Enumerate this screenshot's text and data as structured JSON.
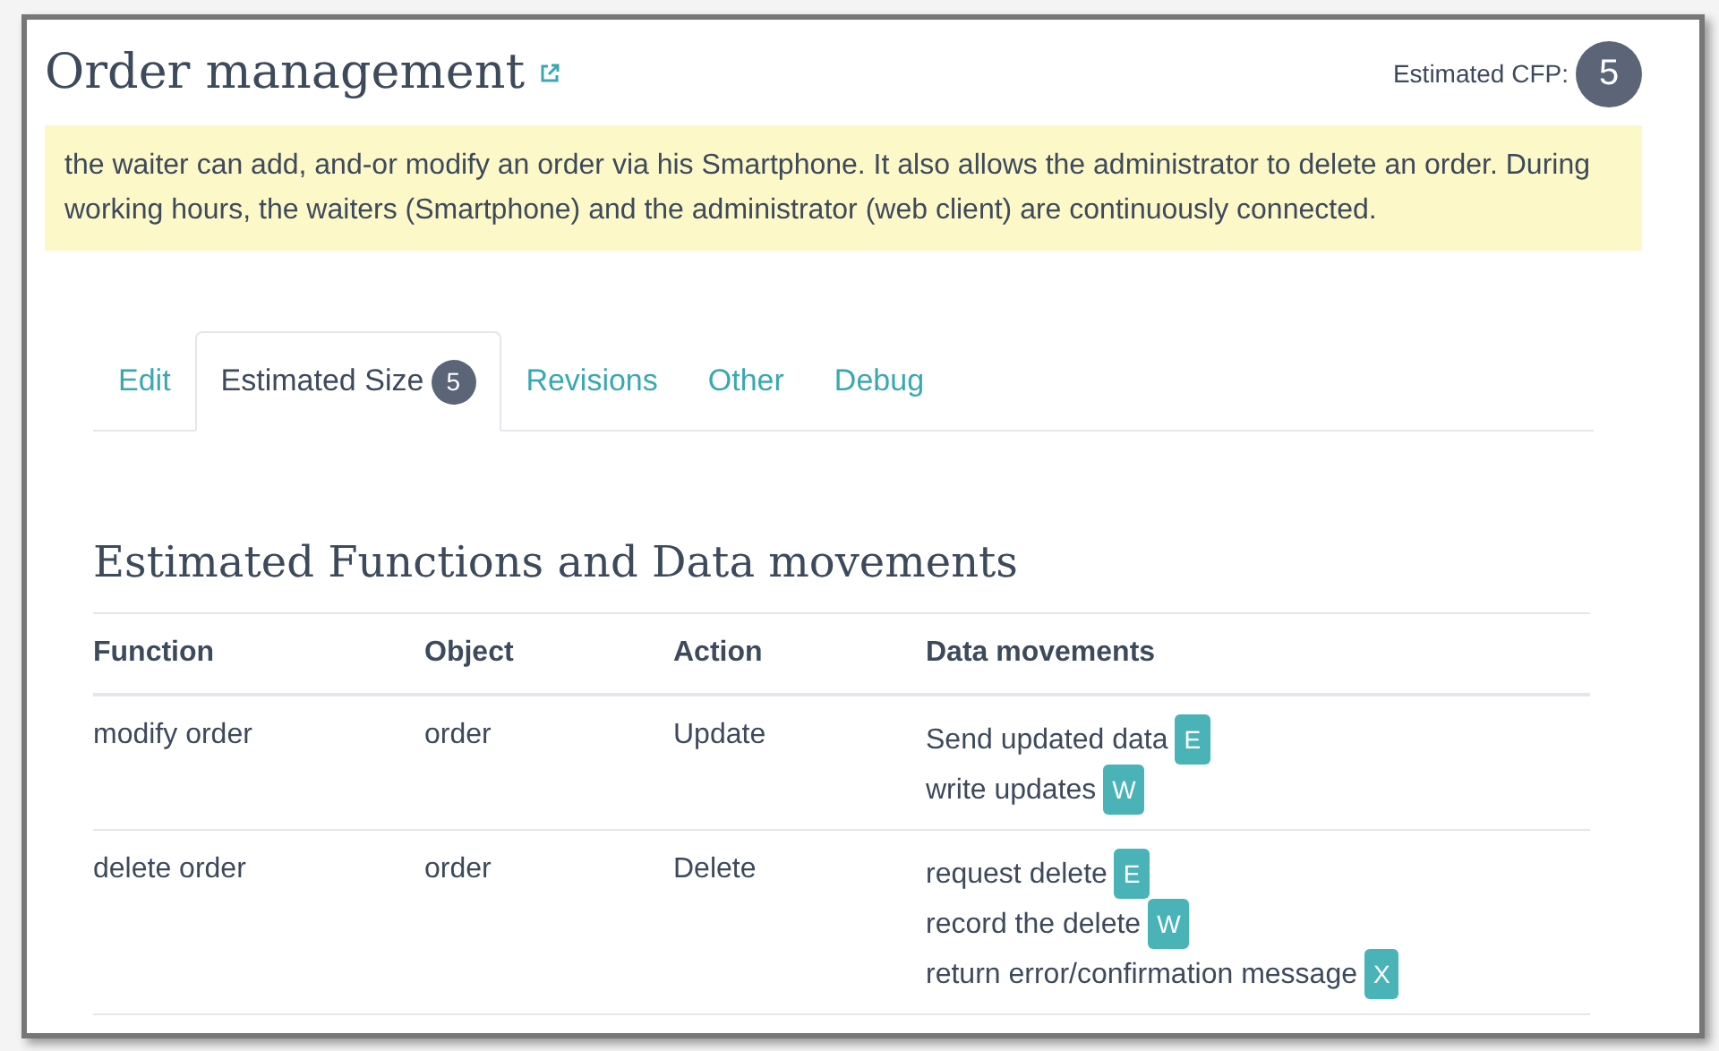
{
  "title": "Order management",
  "cfp": {
    "label": "Estimated CFP:",
    "value": "5"
  },
  "description": "the waiter can add, and-or modify an order via his Smartphone. It also allows the administrator to delete an order. During working hours, the waiters (Smartphone) and the administrator (web client) are continuously connected.",
  "tabs": [
    {
      "label": "Edit",
      "selected": false
    },
    {
      "label": "Estimated Size",
      "badge": "5",
      "selected": true
    },
    {
      "label": "Revisions",
      "selected": false
    },
    {
      "label": "Other",
      "selected": false
    },
    {
      "label": "Debug",
      "selected": false
    }
  ],
  "section_title": "Estimated Functions and Data movements",
  "table": {
    "columns": [
      "Function",
      "Object",
      "Action",
      "Data movements"
    ],
    "rows": [
      {
        "function": "modify order",
        "object": "order",
        "action": "Update",
        "movements": [
          {
            "text": "Send updated data",
            "tag": "E"
          },
          {
            "text": "write updates",
            "tag": "W"
          }
        ]
      },
      {
        "function": "delete order",
        "object": "order",
        "action": "Delete",
        "movements": [
          {
            "text": "request delete",
            "tag": "E"
          },
          {
            "text": "record the delete",
            "tag": "W"
          },
          {
            "text": "return error/confirmation message",
            "tag": "X"
          }
        ]
      }
    ]
  }
}
